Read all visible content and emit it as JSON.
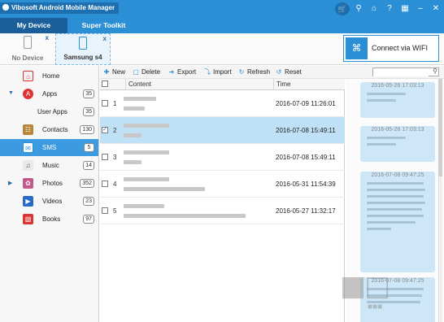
{
  "app": {
    "title": "Vibosoft Android Mobile Manager",
    "accent": "#2b8fd6",
    "title_icons": [
      "cart-icon",
      "key-icon",
      "home-icon",
      "help-icon",
      "menu-icon",
      "minimize-icon",
      "close-icon"
    ]
  },
  "tabs": [
    {
      "label": "My Device",
      "active": true
    },
    {
      "label": "Super Toolkit",
      "active": false
    }
  ],
  "devices": [
    {
      "label": "No Device",
      "icon": "phone-icon",
      "close": "x"
    },
    {
      "label": "Samsung s4",
      "icon": "phone-icon",
      "close": "x",
      "active": true
    }
  ],
  "wifi_button": {
    "label": "Connect via WIFI",
    "icon": "wifi-icon"
  },
  "sidebar": {
    "items": [
      {
        "label": "Home",
        "icon": "home-icon",
        "count": ""
      },
      {
        "label": "Apps",
        "icon": "apps-icon",
        "count": "35",
        "expanded": true
      },
      {
        "label": "User Apps",
        "icon": "",
        "count": "35",
        "sub": true
      },
      {
        "label": "Contacts",
        "icon": "contacts-icon",
        "count": "130"
      },
      {
        "label": "SMS",
        "icon": "sms-icon",
        "count": "5",
        "active": true
      },
      {
        "label": "Music",
        "icon": "music-icon",
        "count": "14"
      },
      {
        "label": "Photos",
        "icon": "photos-icon",
        "count": "352",
        "collapsed": true
      },
      {
        "label": "Videos",
        "icon": "videos-icon",
        "count": "23"
      },
      {
        "label": "Books",
        "icon": "books-icon",
        "count": "97"
      }
    ]
  },
  "toolbar": {
    "new": "New",
    "delete": "Delete",
    "export": "Export",
    "import": "Import",
    "refresh": "Refresh",
    "reset": "Reset",
    "search_placeholder": ""
  },
  "table": {
    "columns": [
      "Content",
      "Time"
    ],
    "rows": [
      {
        "num": "1",
        "time": "2016-07-09 11:26:01",
        "checked": false
      },
      {
        "num": "2",
        "time": "2016-07-08 15:49:11",
        "checked": true
      },
      {
        "num": "3",
        "time": "2016-07-08 15:49:11",
        "checked": false
      },
      {
        "num": "4",
        "time": "2016-05-31 11:54:39",
        "checked": false
      },
      {
        "num": "5",
        "time": "2016-05-27 11:32:17",
        "checked": false
      }
    ]
  },
  "conversation": {
    "messages": [
      {
        "time": "2016-05-26 17:03:13"
      },
      {
        "time": "2016-05-26 17:03:13"
      },
      {
        "time": "2016-07-08 09:47:25"
      },
      {
        "time": "2016-07-08 09:47:25"
      }
    ]
  }
}
